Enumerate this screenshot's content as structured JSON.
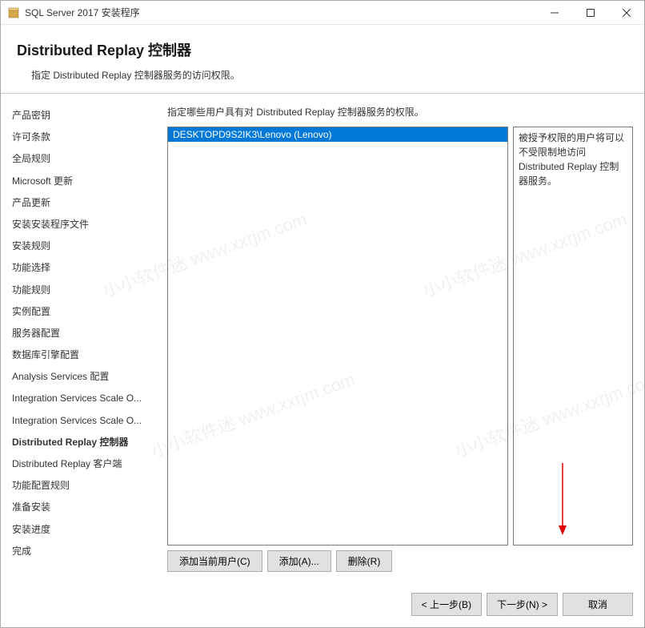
{
  "window": {
    "title": "SQL Server 2017 安装程序"
  },
  "header": {
    "title": "Distributed  Replay 控制器",
    "description": "指定 Distributed Replay 控制器服务的访问权限。"
  },
  "sidebar": {
    "items": [
      {
        "label": "产品密钥"
      },
      {
        "label": "许可条款"
      },
      {
        "label": "全局规则"
      },
      {
        "label": "Microsoft 更新"
      },
      {
        "label": "产品更新"
      },
      {
        "label": "安装安装程序文件"
      },
      {
        "label": "安装规则"
      },
      {
        "label": "功能选择"
      },
      {
        "label": "功能规则"
      },
      {
        "label": "实例配置"
      },
      {
        "label": "服务器配置"
      },
      {
        "label": "数据库引擎配置"
      },
      {
        "label": "Analysis Services 配置"
      },
      {
        "label": "Integration Services Scale O..."
      },
      {
        "label": "Integration Services Scale O..."
      },
      {
        "label": "Distributed Replay 控制器",
        "active": true
      },
      {
        "label": "Distributed Replay 客户端"
      },
      {
        "label": "功能配置规则"
      },
      {
        "label": "准备安装"
      },
      {
        "label": "安装进度"
      },
      {
        "label": "完成"
      }
    ]
  },
  "main": {
    "instruction": "指定哪些用户具有对 Distributed Replay 控制器服务的权限。",
    "users": [
      "DESKTOPD9S2IK3\\Lenovo (Lenovo)"
    ],
    "info_text": "被授予权限的用户将可以不受限制地访问 Distributed Replay 控制器服务。",
    "buttons": {
      "add_current": "添加当前用户(C)",
      "add": "添加(A)...",
      "remove": "删除(R)"
    }
  },
  "footer": {
    "back": "< 上一步(B)",
    "next": "下一步(N) >",
    "cancel": "取消"
  },
  "watermark": {
    "text1": "小小软件迷",
    "text2": "www.xxrjm.com"
  }
}
